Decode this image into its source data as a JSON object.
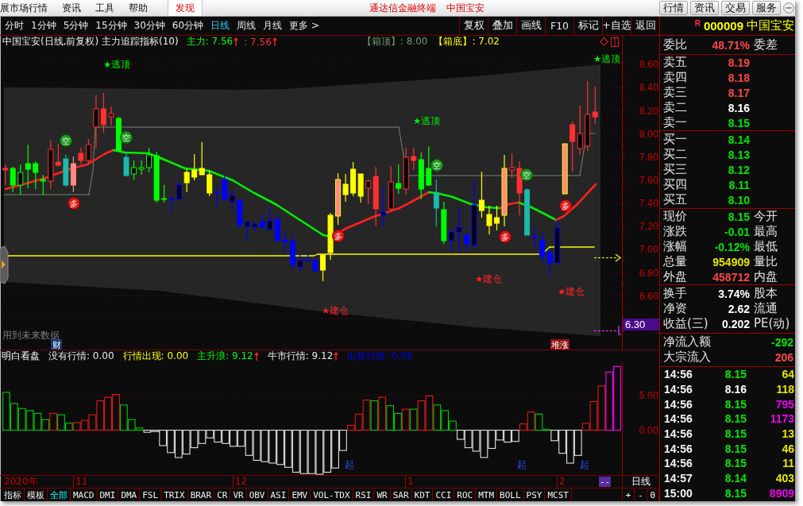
{
  "title_bar": {
    "menus": [
      {
        "label": "展市场行情",
        "selected": false
      },
      {
        "label": "资讯",
        "selected": false
      },
      {
        "label": "工具",
        "selected": false
      },
      {
        "label": "帮助",
        "selected": false
      },
      {
        "label": "发现",
        "selected": true
      }
    ],
    "app_name": "通达信金融终端",
    "stock_name": "中国宝安",
    "buttons": [
      "行情",
      "资讯",
      "交易",
      "服务"
    ]
  },
  "period_tabs": [
    {
      "label": "分时",
      "selected": false
    },
    {
      "label": "1分钟",
      "selected": false
    },
    {
      "label": "5分钟",
      "selected": false
    },
    {
      "label": "15分钟",
      "selected": false
    },
    {
      "label": "30分钟",
      "selected": false
    },
    {
      "label": "60分钟",
      "selected": false
    },
    {
      "label": "日线",
      "selected": true
    },
    {
      "label": "周线",
      "selected": false
    },
    {
      "label": "月线",
      "selected": false
    },
    {
      "label": "更多 >",
      "selected": false
    }
  ],
  "toolbar": [
    "复权",
    "叠加",
    "画线",
    "F10",
    "标记",
    "+自选",
    "返回"
  ],
  "main_chart": {
    "title": "中国宝安(日线,前复权) 主力追踪指标(10)",
    "legend": [
      {
        "text": "主力: 7.56",
        "color": "#00ff00",
        "rising": true
      },
      {
        "text": ": 7.56",
        "color": "#ff3030",
        "rising": true
      }
    ],
    "box_levels": [
      {
        "text": "【箱顶】: 8.00",
        "color": "#6f9a6f"
      },
      {
        "text": "【箱底】: 7.02",
        "color": "#ffff00"
      }
    ],
    "price_ticks": [
      "8.60",
      "8.40",
      "8.20",
      "8.00",
      "7.80",
      "7.60",
      "7.40",
      "7.20",
      "7.00",
      "6.80",
      "6.60"
    ],
    "axis_tag": "6.30",
    "labels": [
      {
        "text": "★逃顶",
        "kind": "top"
      },
      {
        "text": "★逃顶",
        "kind": "top"
      },
      {
        "text": "★逃顶",
        "kind": "top"
      },
      {
        "text": "★建仓",
        "kind": "build"
      },
      {
        "text": "★建仓",
        "kind": "build"
      },
      {
        "text": "★建仓",
        "kind": "build"
      }
    ],
    "signals": [
      {
        "text": "空",
        "kind": "short"
      },
      {
        "text": "多",
        "kind": "long"
      },
      {
        "text": "空",
        "kind": "short"
      },
      {
        "text": "多",
        "kind": "long"
      },
      {
        "text": "空",
        "kind": "short"
      },
      {
        "text": "多",
        "kind": "long"
      },
      {
        "text": "空",
        "kind": "short"
      },
      {
        "text": "多",
        "kind": "long"
      }
    ],
    "note": "用到未来数据",
    "badges": [
      {
        "text": "财",
        "kind": "finance"
      },
      {
        "text": "堆涨",
        "kind": "event"
      }
    ]
  },
  "indicator_panel": {
    "name": "明白看盘",
    "legend": [
      {
        "text": "没有行情: 0.00",
        "color": "#e8e8e8",
        "rising": false
      },
      {
        "text": "行情出现: 0.00",
        "color": "#ffff00",
        "rising": false
      },
      {
        "text": "主升浪: 9.12",
        "color": "#00ff00",
        "rising": true
      },
      {
        "text": "牛市行情: 9.12",
        "color": "#e8e8e8",
        "rising": true
      },
      {
        "text": "出货行情: 0.00",
        "color": "#0000ff",
        "rising": false
      }
    ],
    "chart_data": {
      "type": "bar",
      "values": [
        5.4,
        3.8,
        3.1,
        2.8,
        2.4,
        1.5,
        2.4,
        2.2,
        1.0,
        1.1,
        1.4,
        2.2,
        4.2,
        4.7,
        5.1,
        3.6,
        1.5,
        0.3,
        -0.3,
        -0.2,
        -2.2,
        -3.2,
        -3.9,
        -3.4,
        -2.5,
        -1.9,
        -1.1,
        -1.7,
        -1.9,
        -2.3,
        -2.3,
        -3.6,
        -4.3,
        -4.5,
        -4.7,
        -4.9,
        -5.3,
        -6.0,
        -6.2,
        -6.2,
        -6.3,
        -6.0,
        -5.4,
        -2.9,
        0.7,
        2.3,
        4.3,
        4.2,
        4.7,
        3.5,
        2.4,
        3.0,
        3.0,
        4.2,
        4.9,
        3.6,
        2.8,
        1.3,
        -1.3,
        -2.5,
        -3.0,
        -3.9,
        -2.6,
        -1.4,
        -1.7,
        -1.6,
        0.9,
        2.6,
        2.3,
        0.1,
        -1.5,
        -3.3,
        -4.7,
        -3.6,
        1.0,
        4.1,
        6.3,
        8.3,
        9.1
      ],
      "ylim": [
        -6.4,
        9.7
      ],
      "yticks": [
        {
          "value": 5,
          "label": "5.00"
        },
        {
          "value": 0,
          "label": "0.00"
        }
      ],
      "annotations": [
        "起",
        "起",
        "起"
      ]
    }
  },
  "date_axis": {
    "labels": [
      "2020年",
      "11",
      "12",
      "1",
      "2"
    ],
    "cursor": "--",
    "period": "日线"
  },
  "indicator_tabs": [
    {
      "label": "指标",
      "selected": false
    },
    {
      "label": "模板",
      "selected": false
    },
    {
      "label": "全部",
      "selected": true
    },
    {
      "label": "MACD",
      "selected": false
    },
    {
      "label": "DMI",
      "selected": false
    },
    {
      "label": "DMA",
      "selected": false
    },
    {
      "label": "FSL",
      "selected": false
    },
    {
      "label": "TRIX",
      "selected": false
    },
    {
      "label": "BRAR",
      "selected": false
    },
    {
      "label": "CR",
      "selected": false
    },
    {
      "label": "VR",
      "selected": false
    },
    {
      "label": "OBV",
      "selected": false
    },
    {
      "label": "ASI",
      "selected": false
    },
    {
      "label": "EMV",
      "selected": false
    },
    {
      "label": "VOL-TDX",
      "selected": false
    },
    {
      "label": "RSI",
      "selected": false
    },
    {
      "label": "WR",
      "selected": false
    },
    {
      "label": "SAR",
      "selected": false
    },
    {
      "label": "KDT",
      "selected": false
    },
    {
      "label": "CCI",
      "selected": false
    },
    {
      "label": "ROC",
      "selected": false
    },
    {
      "label": "MTM",
      "selected": false
    },
    {
      "label": "BOLL",
      "selected": false
    },
    {
      "label": "PSY",
      "selected": false
    },
    {
      "label": "MCST",
      "selected": false
    }
  ],
  "zoom_controls": [
    "+",
    "-",
    "0"
  ],
  "quote_panel": {
    "header": {
      "flag": "R",
      "code": "000009",
      "name": "中国宝安"
    },
    "order_ratio": {
      "label": "委比",
      "value": "48.71%",
      "color": "#ff4545",
      "label2": "委差"
    },
    "asks": [
      {
        "label": "卖五",
        "price": "8.19",
        "color": "#ff4545"
      },
      {
        "label": "卖四",
        "price": "8.18",
        "color": "#ff4545"
      },
      {
        "label": "卖三",
        "price": "8.17",
        "color": "#ff4545"
      },
      {
        "label": "卖二",
        "price": "8.16",
        "color": "#ffffff"
      },
      {
        "label": "卖一",
        "price": "8.15",
        "color": "#00e600"
      }
    ],
    "bids": [
      {
        "label": "买一",
        "price": "8.14",
        "color": "#00e600"
      },
      {
        "label": "买二",
        "price": "8.13",
        "color": "#00e600"
      },
      {
        "label": "买三",
        "price": "8.12",
        "color": "#00e600"
      },
      {
        "label": "买四",
        "price": "8.11",
        "color": "#00e600"
      },
      {
        "label": "买五",
        "price": "8.10",
        "color": "#00e600"
      }
    ],
    "stats": [
      {
        "label": "现价",
        "value": "8.15",
        "color": "#00e600",
        "label2": "今开"
      },
      {
        "label": "涨跌",
        "value": "-0.01",
        "color": "#00e600",
        "label2": "最高"
      },
      {
        "label": "涨幅",
        "value": "-0.12%",
        "color": "#00e600",
        "label2": "最低"
      },
      {
        "label": "总量",
        "value": "954909",
        "color": "#e6e600",
        "label2": "量比"
      },
      {
        "label": "外盘",
        "value": "458712",
        "color": "#ff4545",
        "label2": "内盘"
      }
    ],
    "fundamentals": [
      {
        "label": "换手",
        "value": "3.74%",
        "color": "#ffffff",
        "label2": "股本"
      },
      {
        "label": "净资",
        "value": "2.62",
        "color": "#ffffff",
        "label2": "流通"
      },
      {
        "label": "收益(三)",
        "value": "0.202",
        "color": "#ffffff",
        "label2": "PE(动)"
      }
    ],
    "flows": [
      {
        "label": "净流入额",
        "value": "-292",
        "color": "#00e600"
      },
      {
        "label": "大宗流入",
        "value": "206",
        "color": "#ff4545"
      }
    ],
    "ticks": [
      {
        "time": "14:56",
        "price": "8.15",
        "color": "#00e600",
        "volume": "64",
        "large": false
      },
      {
        "time": "14:56",
        "price": "8.16",
        "color": "#ffffff",
        "volume": "118",
        "large": false
      },
      {
        "time": "14:56",
        "price": "8.15",
        "color": "#00e600",
        "volume": "795",
        "large": true
      },
      {
        "time": "14:56",
        "price": "8.15",
        "color": "#00e600",
        "volume": "1173",
        "large": true
      },
      {
        "time": "14:56",
        "price": "8.15",
        "color": "#00e600",
        "volume": "13",
        "large": false
      },
      {
        "time": "14:56",
        "price": "8.15",
        "color": "#00e600",
        "volume": "46",
        "large": false
      },
      {
        "time": "14:56",
        "price": "8.15",
        "color": "#00e600",
        "volume": "11",
        "large": false
      },
      {
        "time": "14:57",
        "price": "8.14",
        "color": "#00e600",
        "volume": "403",
        "large": false
      },
      {
        "time": "15:00",
        "price": "8.15",
        "color": "#00e600",
        "volume": "8909",
        "large": true
      }
    ]
  }
}
